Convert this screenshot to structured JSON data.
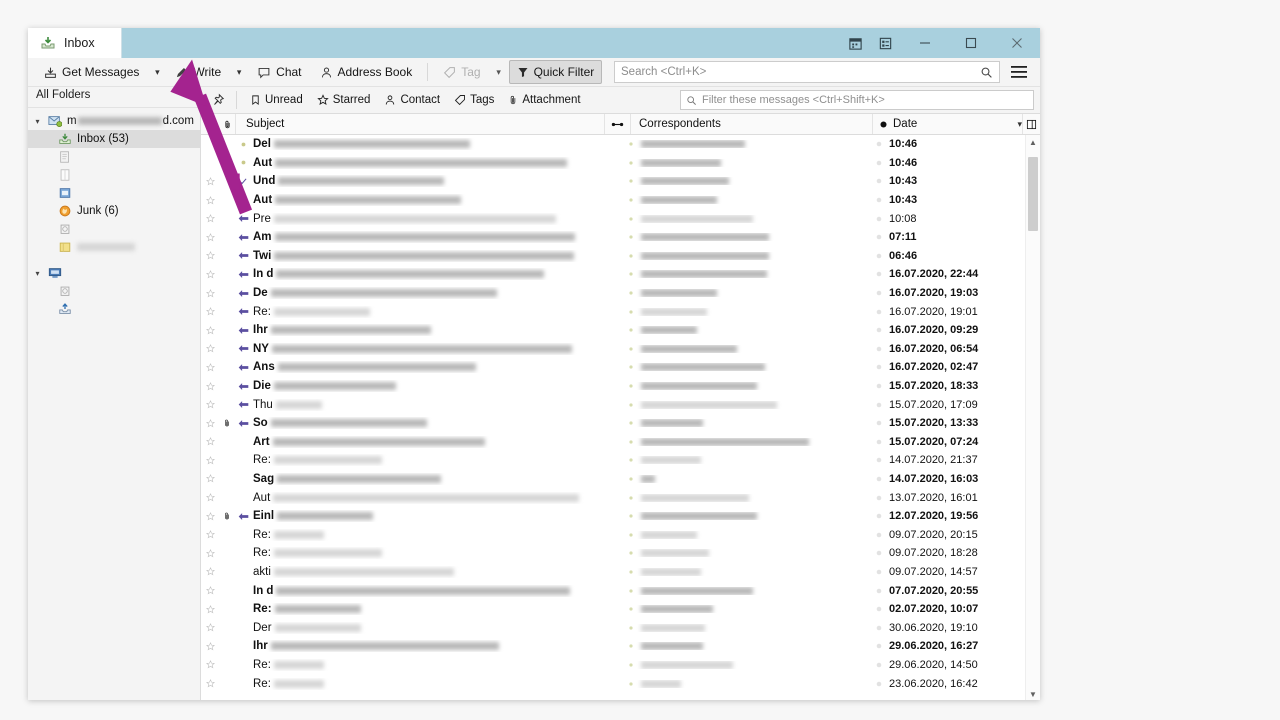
{
  "window": {
    "tab_title": "Inbox",
    "tab_icon": "inbox-icon",
    "titlebar_color": "#a9d0de",
    "icons": [
      {
        "name": "calendar-icon",
        "label": "Calendar"
      },
      {
        "name": "tasks-icon",
        "label": "Tasks"
      }
    ],
    "controls": [
      {
        "name": "minimize-button",
        "glyph": "—"
      },
      {
        "name": "maximize-button",
        "glyph": "□"
      },
      {
        "name": "close-button",
        "glyph": "✕"
      }
    ]
  },
  "toolbar": {
    "get_messages": "Get Messages",
    "write": "Write",
    "chat": "Chat",
    "address_book": "Address Book",
    "tag": "Tag",
    "quick_filter": "Quick Filter",
    "search_placeholder": "Search <Ctrl+K>",
    "menu_icon": "hamburger-menu-icon"
  },
  "sidebar": {
    "header": "All Folders",
    "account": {
      "prefix": "m",
      "suffix": "d.com",
      "icon": "account-icon"
    },
    "items": [
      {
        "name": "inbox",
        "label": "Inbox",
        "count": "(53)",
        "icon": "inbox-folder-icon",
        "selected": true,
        "redacted": false,
        "indent": 1
      },
      {
        "name": "folder-drafts",
        "label": "",
        "icon": "drafts-icon",
        "selected": false,
        "redacted": true,
        "redact_w": 0,
        "indent": 1
      },
      {
        "name": "folder-templates",
        "label": "",
        "icon": "templates-icon",
        "selected": false,
        "redacted": true,
        "redact_w": 0,
        "indent": 1
      },
      {
        "name": "folder-archive",
        "label": "",
        "icon": "archive-blue-icon",
        "selected": false,
        "redacted": true,
        "redact_w": 0,
        "indent": 1
      },
      {
        "name": "folder-junk",
        "label": "Junk",
        "count": "(6)",
        "icon": "junk-icon",
        "selected": false,
        "redacted": false,
        "indent": 1
      },
      {
        "name": "folder-trash",
        "label": "",
        "icon": "trash-icon",
        "selected": false,
        "redacted": true,
        "redact_w": 0,
        "indent": 1
      },
      {
        "name": "folder-custom",
        "label": "",
        "icon": "yellow-folder-icon",
        "selected": false,
        "redacted": true,
        "redact_w": 58,
        "indent": 1
      }
    ],
    "local_account": {
      "icon": "local-folders-icon"
    },
    "local_items": [
      {
        "name": "local-trash",
        "icon": "trash-icon"
      },
      {
        "name": "local-outbox",
        "icon": "outbox-icon"
      }
    ]
  },
  "quick_filter_bar": {
    "pin": "pin-icon",
    "buttons": [
      {
        "name": "unread",
        "label": "Unread",
        "icon": "unread-icon"
      },
      {
        "name": "starred",
        "label": "Starred",
        "icon": "star-icon"
      },
      {
        "name": "contact",
        "label": "Contact",
        "icon": "contact-icon"
      },
      {
        "name": "tags",
        "label": "Tags",
        "icon": "tag-icon"
      },
      {
        "name": "attachment",
        "label": "Attachment",
        "icon": "paperclip-icon"
      }
    ],
    "filter_placeholder": "Filter these messages <Ctrl+Shift+K>"
  },
  "columns": {
    "star": "★",
    "attachment": "paperclip-icon",
    "subject": "Subject",
    "thread": "thread-icon",
    "correspondents": "Correspondents",
    "date": "Date",
    "sort_caret": "⌄",
    "column_picker": "column-picker-icon"
  },
  "messages": [
    {
      "subject_prefix": "Del",
      "date": "10:46",
      "unread": true,
      "star": false,
      "att": false,
      "thread": "dot",
      "subj_w": 196,
      "corr_w": 104
    },
    {
      "subject_prefix": "Aut",
      "date": "10:46",
      "unread": true,
      "star": false,
      "att": false,
      "thread": "dot",
      "subj_w": 292,
      "corr_w": 80
    },
    {
      "subject_prefix": "Und",
      "date": "10:43",
      "unread": true,
      "star": true,
      "att": false,
      "thread": "check",
      "subj_w": 166,
      "corr_w": 88
    },
    {
      "subject_prefix": "Aut",
      "date": "10:43",
      "unread": true,
      "star": true,
      "att": false,
      "thread": "check",
      "subj_w": 186,
      "corr_w": 76
    },
    {
      "subject_prefix": "Pre",
      "date": "10:08",
      "unread": false,
      "star": true,
      "att": false,
      "thread": "reply",
      "subj_w": 282,
      "corr_w": 112
    },
    {
      "subject_prefix": "Am",
      "date": "07:11",
      "unread": true,
      "star": true,
      "att": false,
      "thread": "reply",
      "subj_w": 300,
      "corr_w": 128
    },
    {
      "subject_prefix": "Twi",
      "date": "06:46",
      "unread": true,
      "star": true,
      "att": false,
      "thread": "reply",
      "subj_w": 300,
      "corr_w": 128
    },
    {
      "subject_prefix": "In d",
      "date": "16.07.2020, 22:44",
      "unread": true,
      "star": true,
      "att": false,
      "thread": "reply",
      "subj_w": 268,
      "corr_w": 126
    },
    {
      "subject_prefix": "De",
      "date": "16.07.2020, 19:03",
      "unread": true,
      "star": true,
      "att": false,
      "thread": "reply",
      "subj_w": 226,
      "corr_w": 76
    },
    {
      "subject_prefix": "Re:",
      "date": "16.07.2020, 19:01",
      "unread": false,
      "star": true,
      "att": false,
      "thread": "reply",
      "subj_w": 96,
      "corr_w": 66
    },
    {
      "subject_prefix": "Ihr",
      "date": "16.07.2020, 09:29",
      "unread": true,
      "star": true,
      "att": false,
      "thread": "reply",
      "subj_w": 160,
      "corr_w": 56
    },
    {
      "subject_prefix": "NY",
      "date": "16.07.2020, 06:54",
      "unread": true,
      "star": true,
      "att": false,
      "thread": "reply",
      "subj_w": 300,
      "corr_w": 96
    },
    {
      "subject_prefix": "Ans",
      "date": "16.07.2020, 02:47",
      "unread": true,
      "star": true,
      "att": false,
      "thread": "reply",
      "subj_w": 198,
      "corr_w": 124
    },
    {
      "subject_prefix": "Die",
      "date": "15.07.2020, 18:33",
      "unread": true,
      "star": true,
      "att": false,
      "thread": "reply",
      "subj_w": 122,
      "corr_w": 116
    },
    {
      "subject_prefix": "Thu",
      "date": "15.07.2020, 17:09",
      "unread": false,
      "star": true,
      "att": false,
      "thread": "reply",
      "subj_w": 46,
      "corr_w": 136
    },
    {
      "subject_prefix": "So",
      "date": "15.07.2020, 13:33",
      "unread": true,
      "star": true,
      "att": true,
      "thread": "reply",
      "subj_w": 156,
      "corr_w": 62
    },
    {
      "subject_prefix": "Art",
      "date": "15.07.2020, 07:24",
      "unread": true,
      "star": true,
      "att": false,
      "thread": "none",
      "subj_w": 212,
      "corr_w": 168
    },
    {
      "subject_prefix": "Re:",
      "date": "14.07.2020, 21:37",
      "unread": false,
      "star": true,
      "att": false,
      "thread": "none",
      "subj_w": 108,
      "corr_w": 60
    },
    {
      "subject_prefix": "Sag",
      "date": "14.07.2020, 16:03",
      "unread": true,
      "star": true,
      "att": false,
      "thread": "none",
      "subj_w": 164,
      "corr_w": 14
    },
    {
      "subject_prefix": "Aut",
      "date": "13.07.2020, 16:01",
      "unread": false,
      "star": true,
      "att": false,
      "thread": "none",
      "subj_w": 306,
      "corr_w": 108
    },
    {
      "subject_prefix": "Einl",
      "date": "12.07.2020, 19:56",
      "unread": true,
      "star": true,
      "att": true,
      "thread": "reply",
      "subj_w": 96,
      "corr_w": 116
    },
    {
      "subject_prefix": "Re:",
      "date": "09.07.2020, 20:15",
      "unread": false,
      "star": true,
      "att": false,
      "thread": "none",
      "subj_w": 50,
      "corr_w": 56
    },
    {
      "subject_prefix": "Re:",
      "date": "09.07.2020, 18:28",
      "unread": false,
      "star": true,
      "att": false,
      "thread": "none",
      "subj_w": 108,
      "corr_w": 68
    },
    {
      "subject_prefix": "akti",
      "date": "09.07.2020, 14:57",
      "unread": false,
      "star": true,
      "att": false,
      "thread": "none",
      "subj_w": 180,
      "corr_w": 60
    },
    {
      "subject_prefix": "In d",
      "date": "07.07.2020, 20:55",
      "unread": true,
      "star": true,
      "att": false,
      "thread": "none",
      "subj_w": 294,
      "corr_w": 112
    },
    {
      "subject_prefix": "Re:",
      "date": "02.07.2020, 10:07",
      "unread": true,
      "star": true,
      "att": false,
      "thread": "none",
      "subj_w": 86,
      "corr_w": 72
    },
    {
      "subject_prefix": "Der",
      "date": "30.06.2020, 19:10",
      "unread": false,
      "star": true,
      "att": false,
      "thread": "none",
      "subj_w": 86,
      "corr_w": 64
    },
    {
      "subject_prefix": "Ihr",
      "date": "29.06.2020, 16:27",
      "unread": true,
      "star": true,
      "att": false,
      "thread": "none",
      "subj_w": 228,
      "corr_w": 62
    },
    {
      "subject_prefix": "Re:",
      "date": "29.06.2020, 14:50",
      "unread": false,
      "star": true,
      "att": false,
      "thread": "none",
      "subj_w": 50,
      "corr_w": 92
    },
    {
      "subject_prefix": "Re:",
      "date": "23.06.2020, 16:42",
      "unread": false,
      "star": true,
      "att": false,
      "thread": "none",
      "subj_w": 50,
      "corr_w": 40
    }
  ],
  "annotation": {
    "number": "1",
    "color": "#a4238f",
    "points_to": "write-button"
  }
}
